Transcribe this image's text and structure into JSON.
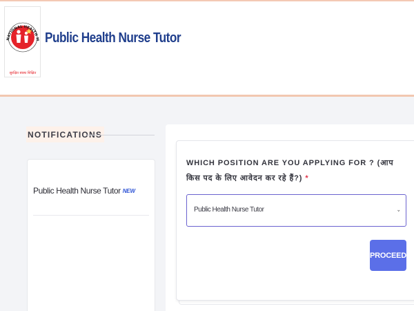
{
  "header": {
    "site_title": "Public Health Nurse Tutor",
    "logo": {
      "icon": "national-health-mission-logo",
      "arc_text": "NATIONAL HEALTH MISSION",
      "tagline": "सुरक्षित स्वस्थ शिक्षित"
    }
  },
  "notifications": {
    "heading": "NOTIFICATIONS",
    "items": [
      {
        "label": "Public Health Nurse Tutor",
        "badge": "NEW"
      }
    ]
  },
  "form": {
    "question": "WHICH POSITION ARE YOU APPLYING FOR ? (आप किस पद के लिए आवेदन कर रहे हैं?)",
    "required_mark": "*",
    "position_select": {
      "selected": "Public Health Nurse Tutor"
    },
    "proceed_label": "PROCEED"
  },
  "colors": {
    "accent": "#5b6fe8",
    "title": "#1f3e8c",
    "header_border": "#f2c7b0",
    "logo_red": "#e5232a"
  }
}
